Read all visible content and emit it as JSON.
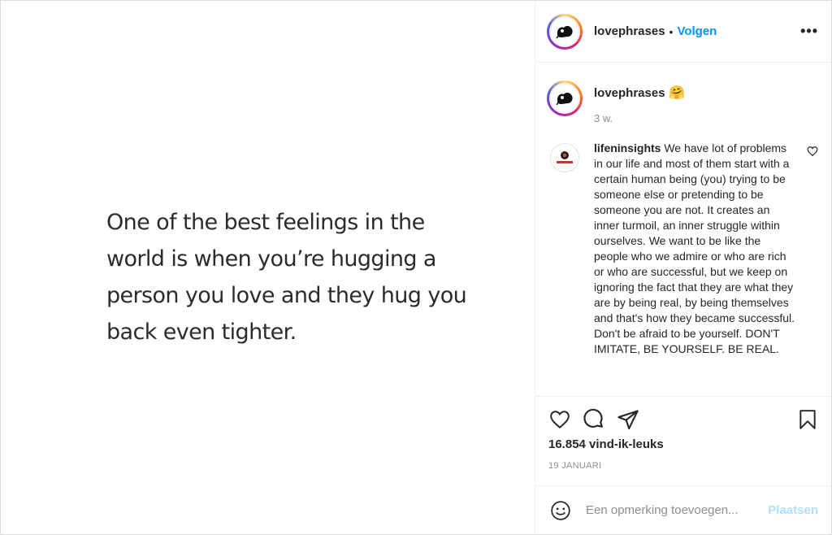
{
  "post": {
    "quote_text": "One of the best feelings in the\nworld is when you’re hugging a\nperson you love and they hug you\nback even tighter."
  },
  "header": {
    "username": "lovephrases",
    "separator": "•",
    "follow_label": "Volgen",
    "more_icon": "more-options-icon",
    "more_label": "•••"
  },
  "caption": {
    "username": "lovephrases",
    "emoji": "🤗",
    "time": "3 w."
  },
  "comments": [
    {
      "username": "lifeninsights",
      "text": "We have lot of problems in our life and most of them start with a certain human being (you) trying to be someone else or pretending to be someone you are not. It creates an inner turmoil, an inner struggle within ourselves. We want to be like the people who we admire or who are rich or who are successful, but we keep on ignoring the fact that they are what they are by being real, by being themselves and that's how they became successful. Don't be afraid to be yourself. DON'T IMITATE, BE YOURSELF. BE REAL."
    }
  ],
  "actions": {
    "likes": "16.854 vind-ik-leuks",
    "date": "19 JANUARI"
  },
  "add_comment": {
    "placeholder": "Een opmerking toevoegen...",
    "post_label": "Plaatsen"
  },
  "colors": {
    "accent": "#0095f6",
    "post_disabled": "#b2dffc",
    "muted": "#8e8e8e",
    "text": "#262626"
  }
}
